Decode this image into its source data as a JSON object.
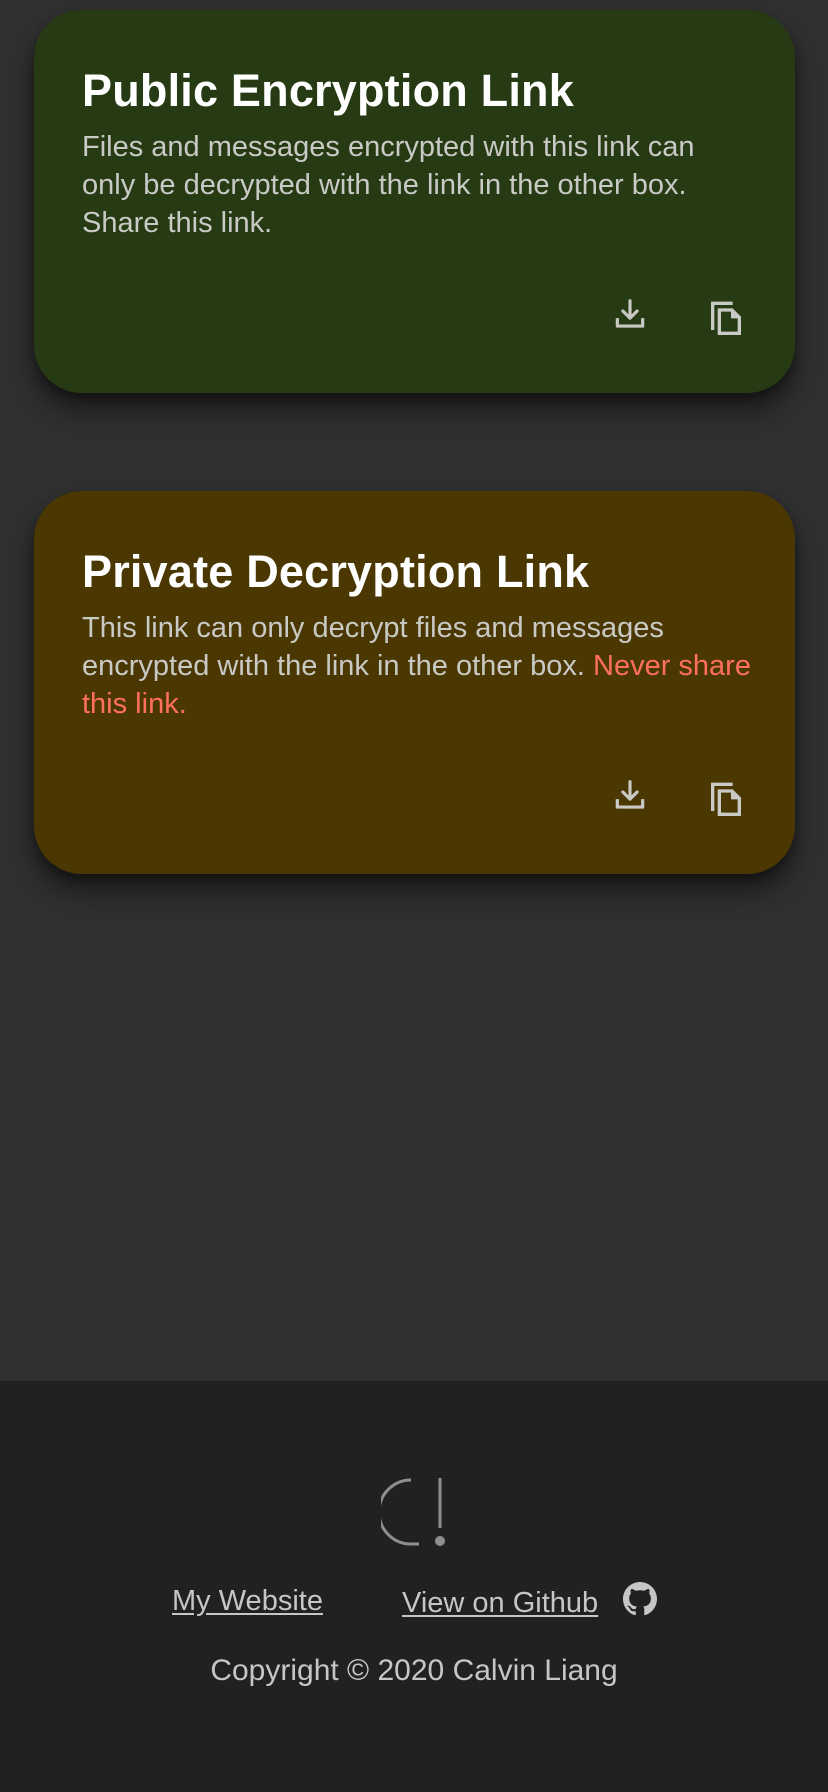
{
  "cards": {
    "public": {
      "title": "Public Encryption Link",
      "description": "Files and messages encrypted with this link can only be decrypted with the link in the other box. Share this link.",
      "background": "#263a13",
      "actions": [
        {
          "icon": "download-icon"
        },
        {
          "icon": "copy-icon"
        }
      ]
    },
    "private": {
      "title": "Private Decryption Link",
      "description": "This link can only decrypt files and messages encrypted with the link in the other box. ",
      "warning": "Never share this link.",
      "warning_color": "#ff6f5e",
      "background": "#4a3702",
      "actions": [
        {
          "icon": "download-icon"
        },
        {
          "icon": "copy-icon"
        }
      ]
    }
  },
  "footer": {
    "logo_icon": "c-exclamation-logo-icon",
    "links": {
      "website": "My Website",
      "github": "View on Github ",
      "github_icon": "github-icon"
    },
    "copyright": "Copyright © 2020 Calvin Liang"
  },
  "colors": {
    "page_background": "#303030",
    "footer_background": "#212121"
  }
}
